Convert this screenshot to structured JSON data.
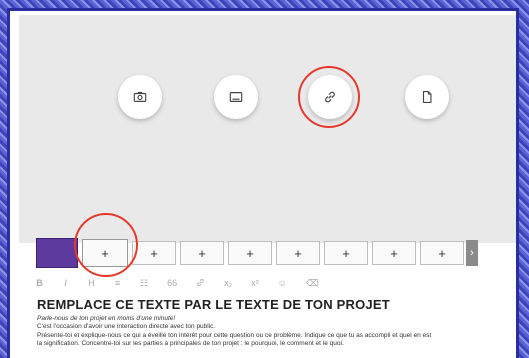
{
  "media_actions": [
    {
      "name": "camera-icon"
    },
    {
      "name": "image-icon"
    },
    {
      "name": "link-icon"
    },
    {
      "name": "file-icon"
    }
  ],
  "slides": {
    "active_label": "",
    "add_label": "+",
    "next_icon": "chevron-right-icon",
    "next_label": "›"
  },
  "toolbar": {
    "bold": "B",
    "italic": "I",
    "heading": "H",
    "list": "≡",
    "list2": "☷",
    "quote": "66",
    "link": "🔗",
    "subscript": "x₂",
    "superscript": "x²",
    "emoji": "☺",
    "clear": "⌫"
  },
  "content": {
    "title": "REMPLACE CE TEXTE PAR LE TEXTE DE TON PROJET",
    "subtitle": "Parle-nous de ton projet en moins d'une minute!",
    "line1": "C'est l'occasion d'avoir une interaction directe avec ton public.",
    "line2": "Présente-toi et explique-nous ce qui a éveillé ton intérêt pour cette question ou ce problème. Indique ce que tu as accompli et quel en est",
    "line3": "la signification. Concentre-toi sur les parties à principales de ton projet : le pourquoi, le comment et le quoi."
  },
  "colors": {
    "highlight": "#e53a2b",
    "frame": "#2b2f9e",
    "active_thumb": "#5c3a9e"
  }
}
